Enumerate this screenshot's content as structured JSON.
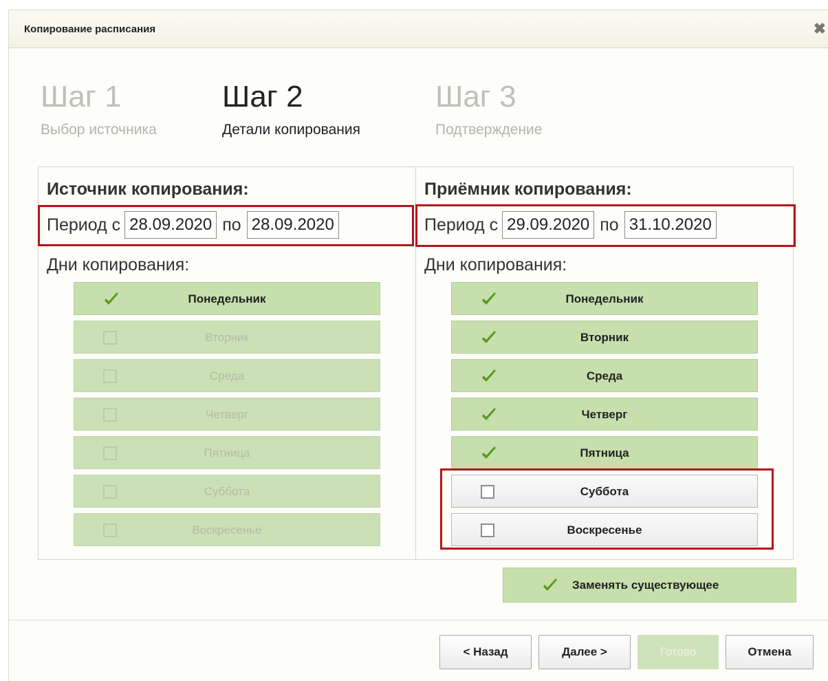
{
  "dialog": {
    "title": "Копирование расписания",
    "close_glyph": "✖"
  },
  "steps": [
    {
      "number": "Шаг 1",
      "desc": "Выбор источника",
      "state": "done"
    },
    {
      "number": "Шаг 2",
      "desc": "Детали копирования",
      "state": "active"
    },
    {
      "number": "Шаг 3",
      "desc": "Подтверждение",
      "state": "pending"
    }
  ],
  "source": {
    "title": "Источник копирования:",
    "period_label": "Период с",
    "to_label": "по",
    "date_from": "28.09.2020",
    "date_to": "28.09.2020",
    "days_label": "Дни копирования:",
    "days": [
      {
        "label": "Понедельник",
        "checked": true,
        "enabled": true
      },
      {
        "label": "Вторник",
        "checked": false,
        "enabled": false
      },
      {
        "label": "Среда",
        "checked": false,
        "enabled": false
      },
      {
        "label": "Четверг",
        "checked": false,
        "enabled": false
      },
      {
        "label": "Пятница",
        "checked": false,
        "enabled": false
      },
      {
        "label": "Суббота",
        "checked": false,
        "enabled": false
      },
      {
        "label": "Воскресенье",
        "checked": false,
        "enabled": false
      }
    ]
  },
  "target": {
    "title": "Приёмник копирования:",
    "period_label": "Период с",
    "to_label": "по",
    "date_from": "29.09.2020",
    "date_to": "31.10.2020",
    "days_label": "Дни копирования:",
    "days": [
      {
        "label": "Понедельник",
        "checked": true,
        "enabled": true
      },
      {
        "label": "Вторник",
        "checked": true,
        "enabled": true
      },
      {
        "label": "Среда",
        "checked": true,
        "enabled": true
      },
      {
        "label": "Четверг",
        "checked": true,
        "enabled": true
      },
      {
        "label": "Пятница",
        "checked": true,
        "enabled": true
      },
      {
        "label": "Суббота",
        "checked": false,
        "enabled": true
      },
      {
        "label": "Воскресенье",
        "checked": false,
        "enabled": true
      }
    ]
  },
  "replace_existing": {
    "label": "Заменять существующее",
    "checked": true
  },
  "footer": {
    "back": "< Назад",
    "next": "Далее >",
    "done": "Готово",
    "cancel": "Отмена"
  },
  "colors": {
    "checked_bg": "#c6dfad",
    "highlight": "#b3141b",
    "check_green": "#5a9a1e"
  }
}
